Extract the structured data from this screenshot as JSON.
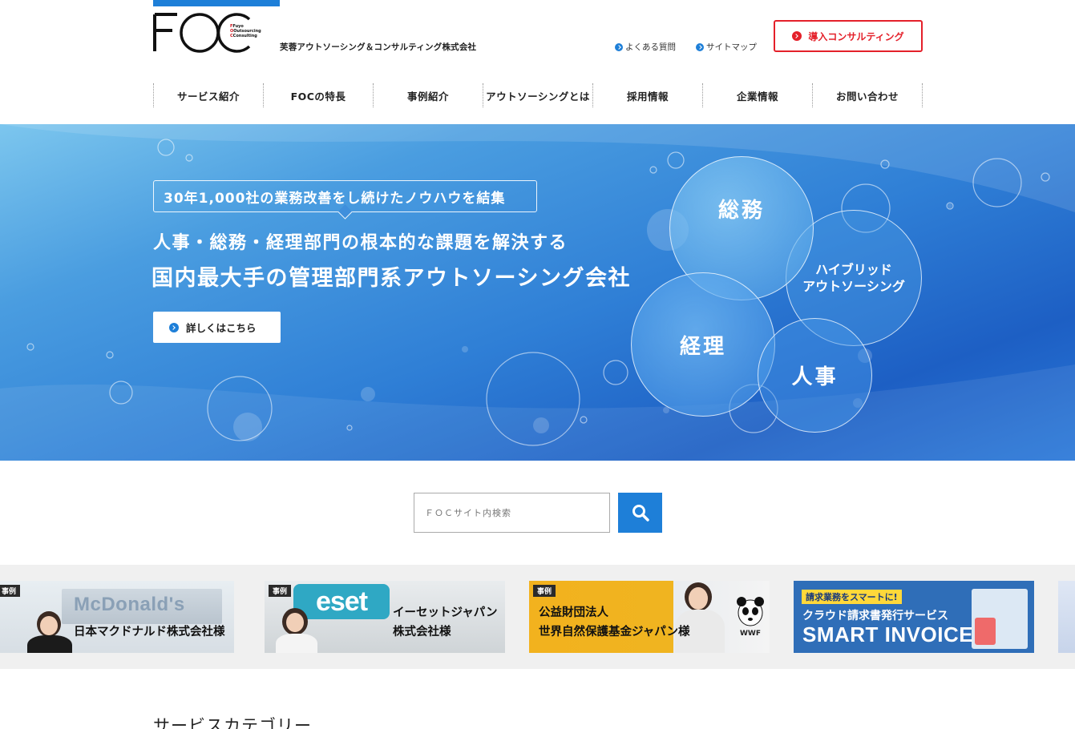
{
  "header": {
    "logo_text": "FOC",
    "logo_sub": [
      "Fuyo",
      "Outsourcing",
      "Consulting"
    ],
    "company_name": "芙蓉アウトソーシング＆コンサルティング株式会社",
    "utility_links": {
      "faq": "よくある質問",
      "sitemap": "サイトマップ"
    },
    "consult_button": "導入コンサルティング",
    "nav": [
      {
        "label": "サービス紹介"
      },
      {
        "label": "FOCの特長"
      },
      {
        "label": "事例紹介"
      },
      {
        "label": "アウトソーシングとは"
      },
      {
        "label": "採用情報"
      },
      {
        "label": "企業情報"
      },
      {
        "label": "お問い合わせ"
      }
    ]
  },
  "hero": {
    "badge": "30年1,000社の業務改善をし続けたノウハウを結集",
    "line1": "人事・総務・経理部門の根本的な課題を解決する",
    "line2": "国内最大手の管理部門系アウトソーシング会社",
    "detail_button": "詳しくはこちら",
    "bubbles": {
      "soumu": "総務",
      "hybrid_line1": "ハイブリッド",
      "hybrid_line2": "アウトソーシング",
      "keiri": "経理",
      "jinji": "人事"
    }
  },
  "search": {
    "placeholder": "ＦＯＣサイト内検索"
  },
  "cases": [
    {
      "tag": "事例",
      "title_lines": [
        "日本マクドナルド株式会社様"
      ],
      "sign_text": "McDonald's"
    },
    {
      "tag": "事例",
      "title_lines": [
        "イーセットジャパン",
        "株式会社様"
      ],
      "logo_text": "eset"
    },
    {
      "tag": "事例",
      "title_lines": [
        "公益財団法人",
        "世界自然保護基金ジャパン様"
      ],
      "logo_text": "WWF"
    }
  ],
  "promo": {
    "pill": "請求業務をスマートに!",
    "sub": "クラウド請求書発行サービス",
    "big": "SMART INVOICE"
  },
  "section": {
    "title": "サービスカテゴリー"
  },
  "colors": {
    "accent": "#1e7fd8",
    "consult_red": "#e4202a"
  }
}
